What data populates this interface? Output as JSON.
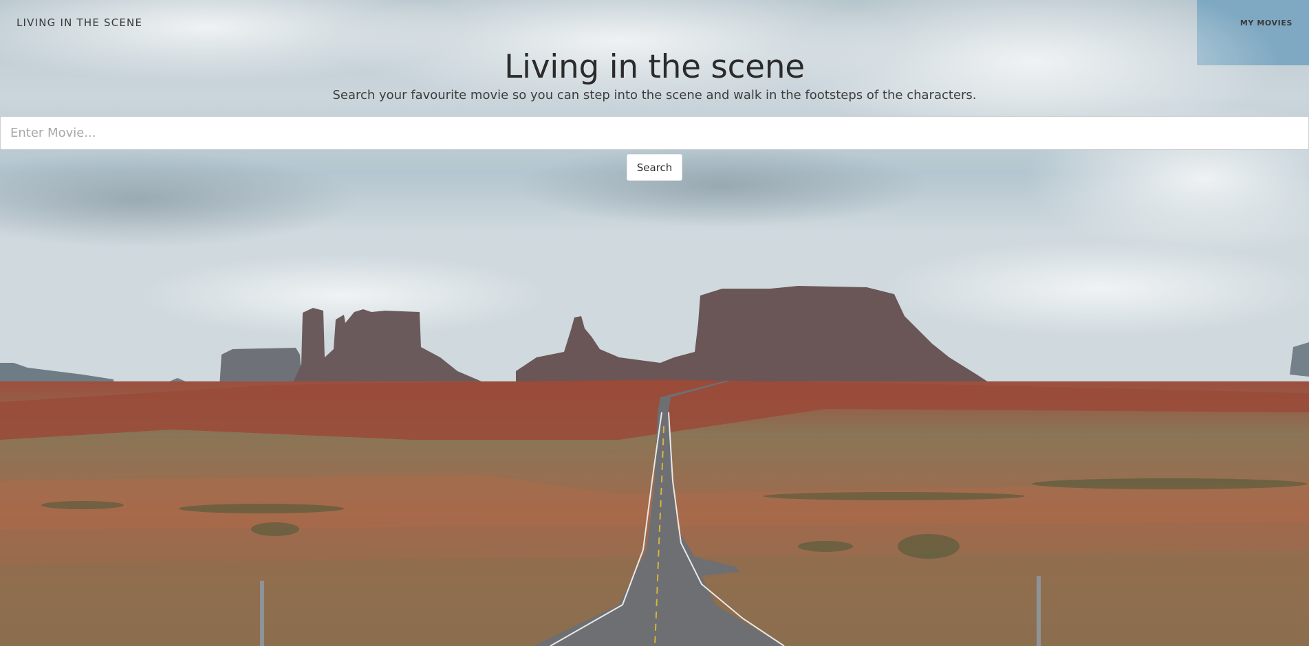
{
  "nav": {
    "brand": "LIVING IN THE SCENE",
    "my_movies": "MY MOVIES"
  },
  "hero": {
    "title": "Living in the scene",
    "subtitle": "Search your favourite movie so you can step into the scene and walk in the footsteps of the characters."
  },
  "search": {
    "placeholder": "Enter Movie...",
    "value": "",
    "button_label": "Search"
  },
  "background": {
    "icon": "desert-road-photo",
    "sky_color": "#c4d3da",
    "rock_color": "#6e5a58",
    "ground_color": "#a96a4b",
    "road_color": "#6e6f72"
  }
}
